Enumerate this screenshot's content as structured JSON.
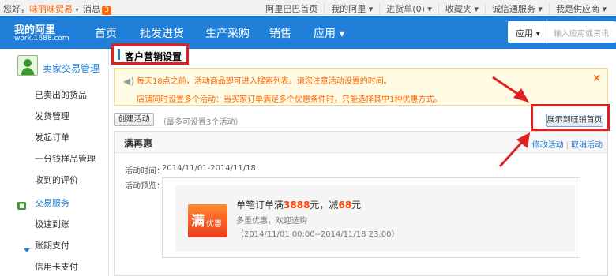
{
  "topbar": {
    "greeting": "您好，",
    "username": "味丽味贸易",
    "messages_label": "消息",
    "messages_count": "3",
    "links": [
      "阿里巴巴首页",
      "我的阿里 ▾",
      "进货单(0) ▾",
      "收藏夹 ▾",
      "诚信通服务 ▾",
      "我是供应商 ▾"
    ]
  },
  "nav": {
    "logo_title": "我的阿里",
    "logo_url": "work.1688.com",
    "items": [
      "首页",
      "批发进货",
      "生产采购",
      "销售",
      "应用 ▾"
    ],
    "search_select": "应用 ▾",
    "search_placeholder": "输入应用或资讯"
  },
  "sidebar": {
    "title": "卖家交易管理",
    "items": [
      "已卖出的货品",
      "发货管理",
      "发起订单",
      "一分钱样品管理",
      "收到的评价",
      "交易服务",
      "极速到账",
      "账期支付",
      "信用卡支付"
    ],
    "green_icon": "shop-icon"
  },
  "page": {
    "title": "客户营销设置"
  },
  "notice": {
    "line1": "每天18点之前，活动商品即可进入搜索列表。请您注意活动设置的时间。",
    "line2": "店铺同时设置多个活动：当买家订单满足多个优惠条件时，只能选择其中1种优惠方式。",
    "close": "×"
  },
  "actions": {
    "create": "创建活动",
    "hint": "（最多可设置3个活动）",
    "show_home": "展示到旺铺首页"
  },
  "promo": {
    "title": "满再惠",
    "edit": "修改活动",
    "cancel": "取消活动",
    "time_label": "活动时间：",
    "time_value": "2014/11/01-2014/11/18",
    "preview_label": "活动预览：",
    "coupon_big": "满",
    "coupon_small": "优惠",
    "line1_pre": "单笔订单满",
    "threshold": "3888",
    "line1_mid": "元，减",
    "discount": "68",
    "line1_post": "元",
    "line2": "多重优惠，欢迎选购",
    "line3": "（2014/11/01 00:00--2014/11/18 23:00）"
  },
  "colors": {
    "nav_blue": "#1f7fd9",
    "accent_orange": "#ff6600",
    "annotation_red": "#e02020"
  }
}
